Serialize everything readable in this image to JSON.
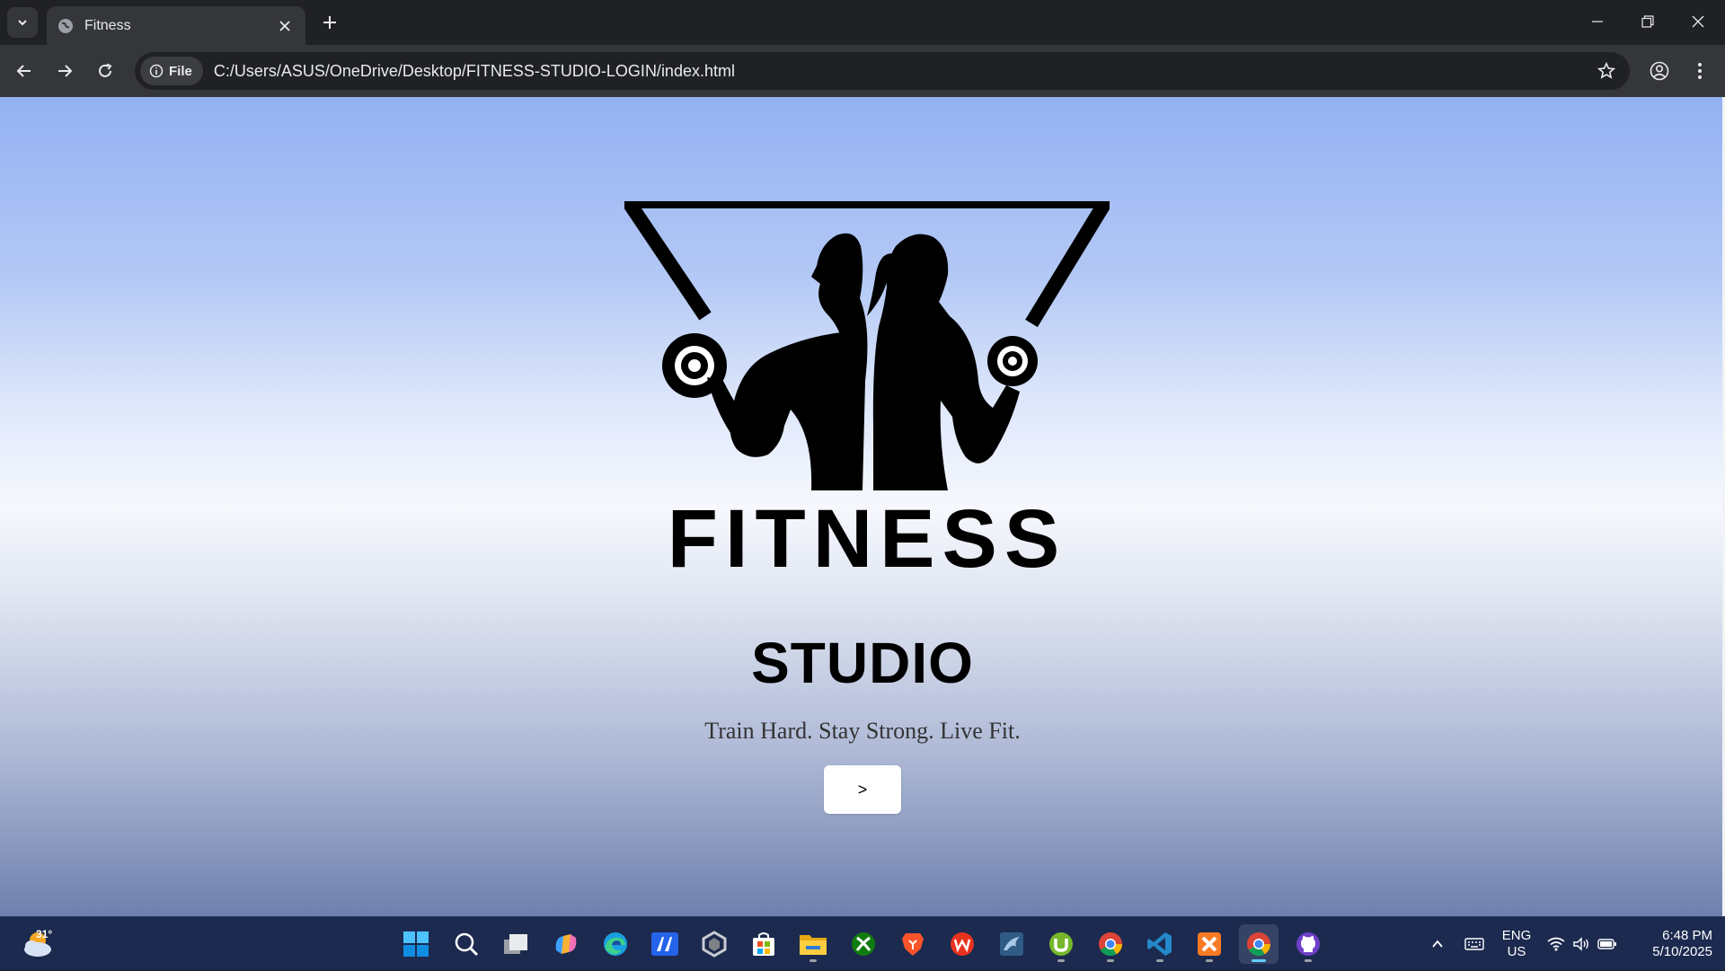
{
  "browser": {
    "tab_title": "Fitness",
    "site_chip": "File",
    "url": "C:/Users/ASUS/OneDrive/Desktop/FITNESS-STUDIO-LOGIN/index.html"
  },
  "page": {
    "logo_wordmark": "FITNESS",
    "heading": "STUDIO",
    "tagline": "Train Hard. Stay Strong. Live Fit.",
    "next_button": ">"
  },
  "taskbar": {
    "weather_temp": "31°",
    "pinned": [
      "start",
      "search",
      "task-view",
      "copilot",
      "edge",
      "ai-app",
      "unity",
      "microsoft-store",
      "file-explorer",
      "xbox",
      "brave",
      "wps-office",
      "mysql-workbench",
      "utorrent",
      "chrome",
      "vs-code",
      "xampp",
      "chrome-active",
      "github-desktop"
    ],
    "lang_line1": "ENG",
    "lang_line2": "US",
    "time": "6:48 PM",
    "date": "5/10/2025"
  },
  "colors": {
    "page_gradient_top": "#93b1f2",
    "page_gradient_mid": "#f6f8fd",
    "page_gradient_bottom": "#6f80ad",
    "taskbar": "#1c2a4f",
    "chrome_dark": "#202124"
  }
}
